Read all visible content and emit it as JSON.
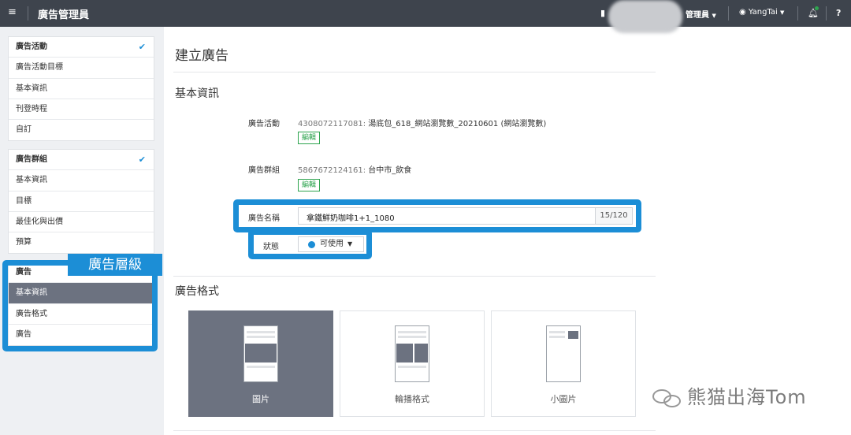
{
  "topbar": {
    "menu_icon": "menu-icon",
    "app_title": "廣告管理員",
    "role_label": "管理員",
    "user_label": "YangTai",
    "bell_icon": "bell-icon",
    "help_icon": "help-icon",
    "user_icon": "user-icon"
  },
  "sidebar": {
    "campaign_group": {
      "items": [
        {
          "label": "廣告活動"
        },
        {
          "label": "廣告活動目標"
        },
        {
          "label": "基本資訊"
        },
        {
          "label": "刊登時程"
        },
        {
          "label": "自訂"
        }
      ]
    },
    "adgroup_group": {
      "items": [
        {
          "label": "廣告群組"
        },
        {
          "label": "基本資訊"
        },
        {
          "label": "目標"
        },
        {
          "label": "最佳化與出價"
        },
        {
          "label": "預算"
        }
      ]
    },
    "ad_group": {
      "items": [
        {
          "label": "廣告"
        },
        {
          "label": "基本資訊"
        },
        {
          "label": "廣告格式"
        },
        {
          "label": "廣告"
        }
      ]
    },
    "annotation_label": "廣告層級",
    "check_icon": "check-icon"
  },
  "main": {
    "page_title": "建立廣告",
    "section_basic": "基本資訊",
    "campaign": {
      "label": "廣告活動",
      "id": "4308072117081:",
      "name": "湯底包_618_網站瀏覽數_20210601 (網站瀏覽數)",
      "edit": "編輯"
    },
    "adgroup": {
      "label": "廣告群組",
      "id": "5867672124161:",
      "name": "台中市_飲食",
      "edit": "編輯"
    },
    "ad_name": {
      "label": "廣告名稱",
      "value": "拿鐵鮮奶咖啡1+1_1080",
      "counter": "15/120"
    },
    "status": {
      "label": "狀態",
      "value": "可使用"
    },
    "section_format": "廣告格式",
    "formats": [
      {
        "label": "圖片",
        "selected": true
      },
      {
        "label": "輪播格式",
        "selected": false
      },
      {
        "label": "小圖片",
        "selected": false
      }
    ]
  },
  "watermark": {
    "text": "熊猫出海Tom",
    "icon": "wechat-icon"
  },
  "colors": {
    "topbar": "#3e444d",
    "accent": "#1c8ed6",
    "selected": "#6c7280",
    "edit_green": "#2ea44f"
  }
}
